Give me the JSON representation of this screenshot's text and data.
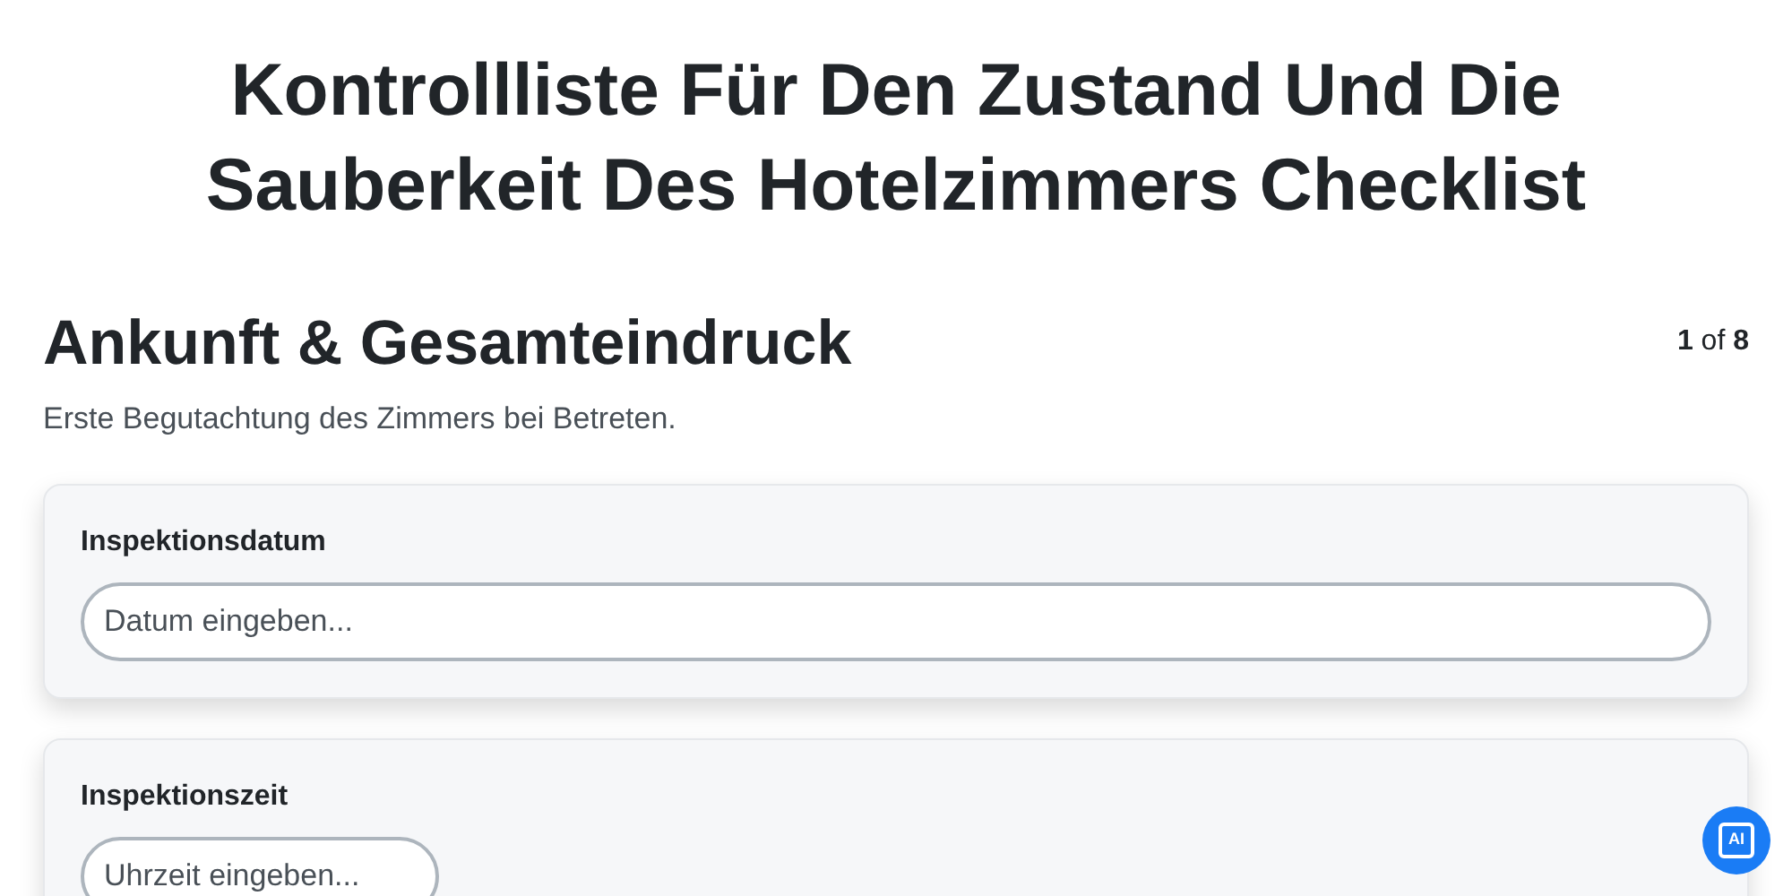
{
  "title": "Kontrollliste Für Den Zustand Und Die Sauberkeit Des Hotelzimmers Checklist",
  "section": {
    "heading": "Ankunft & Gesamteindruck",
    "counter": "**1** of **8**",
    "description": "Erste Begutachtung des Zimmers bei Betreten."
  },
  "fields": [
    {
      "label": "Inspektionsdatum",
      "placeholder": "Datum eingeben...",
      "kind": "wide"
    },
    {
      "label": "Inspektionszeit",
      "placeholder": "Uhrzeit eingeben...",
      "kind": "narrow"
    }
  ],
  "assistant_button": {
    "label": "AI"
  }
}
